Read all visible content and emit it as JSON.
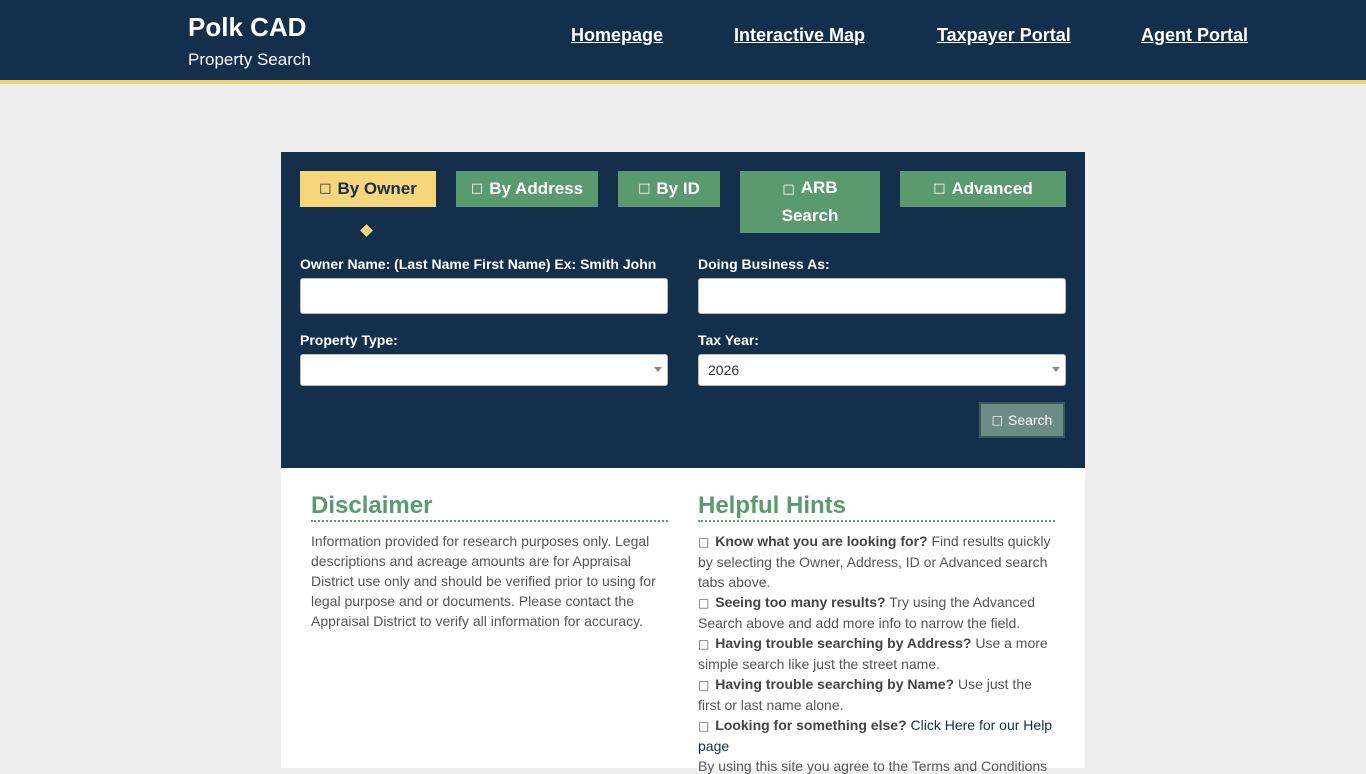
{
  "header": {
    "title": "Polk CAD",
    "subtitle": "Property Search",
    "nav": [
      "Homepage",
      "Interactive Map",
      "Taxpayer Portal",
      "Agent Portal"
    ]
  },
  "tabs": [
    {
      "label": "By Owner",
      "icon": "user-icon",
      "active": true
    },
    {
      "label": "By Address",
      "icon": "home-icon",
      "active": false
    },
    {
      "label": "By ID",
      "icon": "id-icon",
      "active": false
    },
    {
      "label_line1": "ARB",
      "label_line2": "Search",
      "icon": "gavel-icon",
      "active": false
    },
    {
      "label": "Advanced",
      "icon": "sliders-icon",
      "active": false
    }
  ],
  "form": {
    "owner_label": "Owner Name: (Last Name First Name) Ex: Smith John",
    "owner_value": "",
    "dba_label": "Doing Business As:",
    "dba_value": "",
    "property_type_label": "Property Type:",
    "property_type_value": "",
    "tax_year_label": "Tax Year:",
    "tax_year_value": "2026",
    "search_label": "Search"
  },
  "disclaimer": {
    "title": "Disclaimer",
    "text": "Information provided for research purposes only. Legal descriptions and acreage amounts are for Appraisal District use only and should be verified prior to using for legal purpose and or documents. Please contact the Appraisal District to verify all information for accuracy."
  },
  "hints": {
    "title": "Helpful Hints",
    "items": [
      {
        "bold": "Know what you are looking for?",
        "text": " Find results quickly by selecting the Owner, Address, ID or Advanced search tabs above."
      },
      {
        "bold": "Seeing too many results?",
        "text": " Try using the Advanced Search above and add more info to narrow the field."
      },
      {
        "bold": "Having trouble searching by Address?",
        "text": " Use a more simple search like just the street name."
      },
      {
        "bold": "Having trouble searching by Name?",
        "text": " Use just the first or last name alone."
      },
      {
        "bold": "Looking for something else?",
        "link": "Click Here for our Help page"
      }
    ],
    "cutoff_text": "By using this site you agree to the Terms and Conditions"
  },
  "colors": {
    "navy": "#132f4c",
    "green": "#5a9a6e",
    "gold": "#f7d57a"
  }
}
